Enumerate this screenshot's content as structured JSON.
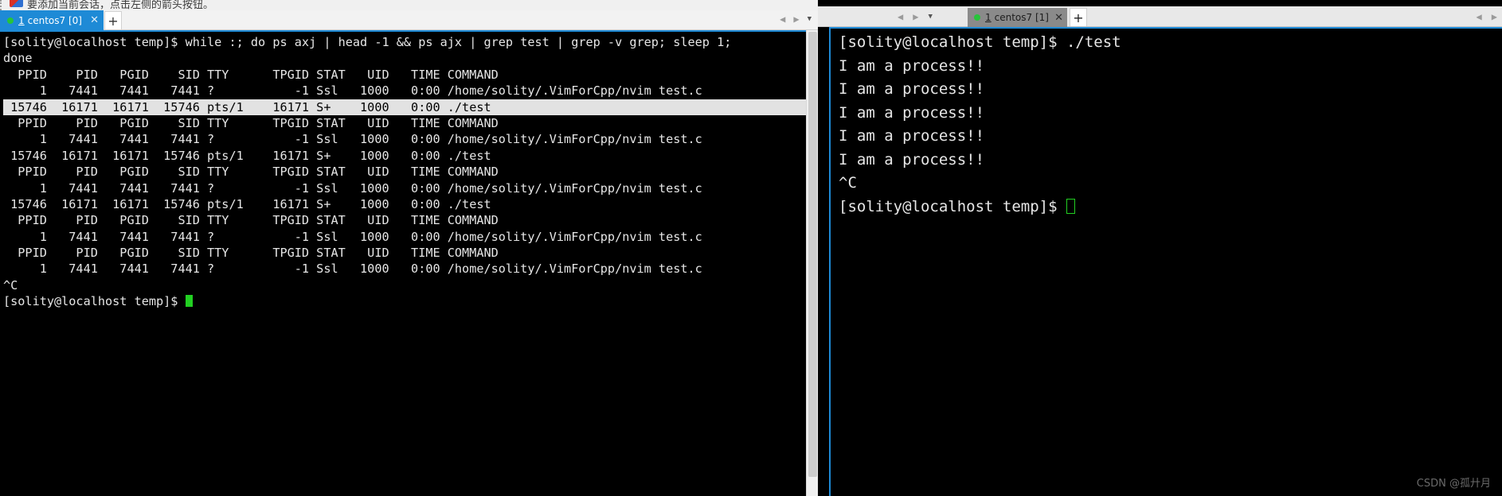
{
  "hint": {
    "text": "要添加当前会话，点击左侧的箭头按钮。",
    "icon": "flag-icon"
  },
  "left_pane": {
    "tab": {
      "number": "1",
      "label": "centos7 [0]",
      "close": "✕",
      "status_dot": "green-status-dot"
    },
    "new_tab_label": "+",
    "nav": {
      "prev": "◀",
      "next": "▶",
      "menu": "▼"
    },
    "terminal_lines": [
      {
        "text": "[solity@localhost temp]$ while :; do ps axj | head -1 && ps ajx | grep test | grep -v grep; sleep 1;",
        "highlight": false
      },
      {
        "text": "done",
        "highlight": false
      },
      {
        "text": "  PPID    PID   PGID    SID TTY      TPGID STAT   UID   TIME COMMAND",
        "highlight": false
      },
      {
        "text": "     1   7441   7441   7441 ?           -1 Ssl   1000   0:00 /home/solity/.VimForCpp/nvim test.c",
        "highlight": false
      },
      {
        "text": " 15746  16171  16171  15746 pts/1    16171 S+    1000   0:00 ./test",
        "highlight": true
      },
      {
        "text": "  PPID    PID   PGID    SID TTY      TPGID STAT   UID   TIME COMMAND",
        "highlight": false
      },
      {
        "text": "     1   7441   7441   7441 ?           -1 Ssl   1000   0:00 /home/solity/.VimForCpp/nvim test.c",
        "highlight": false
      },
      {
        "text": " 15746  16171  16171  15746 pts/1    16171 S+    1000   0:00 ./test",
        "highlight": false
      },
      {
        "text": "  PPID    PID   PGID    SID TTY      TPGID STAT   UID   TIME COMMAND",
        "highlight": false
      },
      {
        "text": "     1   7441   7441   7441 ?           -1 Ssl   1000   0:00 /home/solity/.VimForCpp/nvim test.c",
        "highlight": false
      },
      {
        "text": " 15746  16171  16171  15746 pts/1    16171 S+    1000   0:00 ./test",
        "highlight": false
      },
      {
        "text": "  PPID    PID   PGID    SID TTY      TPGID STAT   UID   TIME COMMAND",
        "highlight": false
      },
      {
        "text": "     1   7441   7441   7441 ?           -1 Ssl   1000   0:00 /home/solity/.VimForCpp/nvim test.c",
        "highlight": false
      },
      {
        "text": "  PPID    PID   PGID    SID TTY      TPGID STAT   UID   TIME COMMAND",
        "highlight": false
      },
      {
        "text": "     1   7441   7441   7441 ?           -1 Ssl   1000   0:00 /home/solity/.VimForCpp/nvim test.c",
        "highlight": false
      },
      {
        "text": "^C",
        "highlight": false
      }
    ],
    "prompt": "[solity@localhost temp]$ "
  },
  "right_pane": {
    "tab": {
      "number": "1",
      "label": "centos7 [1]",
      "close": "✕",
      "status_dot": "green-status-dot"
    },
    "new_tab_label": "+",
    "nav": {
      "prev": "◀",
      "next": "▶",
      "menu": "▼"
    },
    "terminal_lines": [
      "[solity@localhost temp]$ ./test",
      "I am a process!!",
      "I am a process!!",
      "I am a process!!",
      "I am a process!!",
      "I am a process!!",
      "^C"
    ],
    "prompt": "[solity@localhost temp]$ "
  },
  "watermark": "CSDN @孤廾月",
  "colors": {
    "terminal_bg": "#000000",
    "terminal_fg": "#e6e6e6",
    "active_tab_left": "#1e8ad6",
    "active_tab_right": "#8a8a8a",
    "cursor": "#22d022",
    "highlight_bg": "#e2e2e2",
    "status_dot": "#27c43a"
  },
  "ps_table": {
    "columns": [
      "PPID",
      "PID",
      "PGID",
      "SID",
      "TTY",
      "TPGID",
      "STAT",
      "UID",
      "TIME",
      "COMMAND"
    ],
    "rows": [
      [
        "1",
        "7441",
        "7441",
        "7441",
        "?",
        "-1",
        "Ssl",
        "1000",
        "0:00",
        "/home/solity/.VimForCpp/nvim test.c"
      ],
      [
        "15746",
        "16171",
        "16171",
        "15746",
        "pts/1",
        "16171",
        "S+",
        "1000",
        "0:00",
        "./test"
      ]
    ]
  }
}
